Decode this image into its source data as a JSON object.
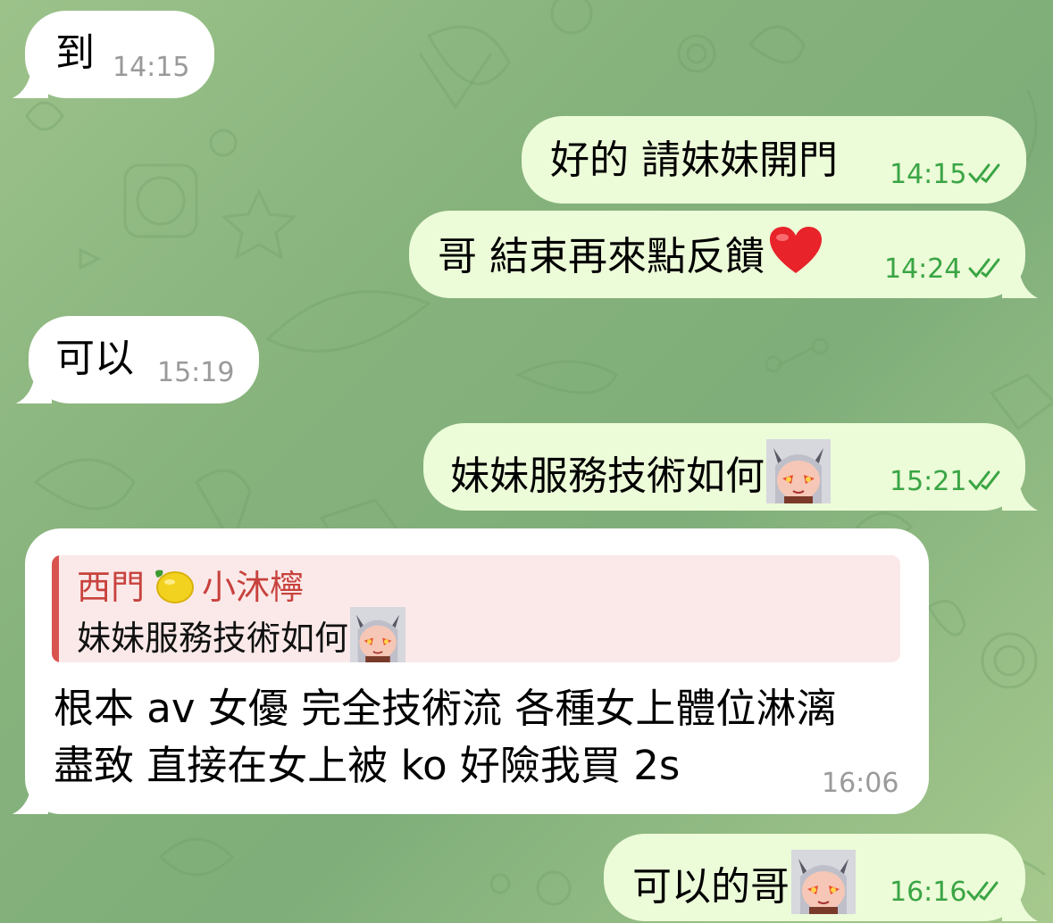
{
  "messages": [
    {
      "id": "m1",
      "direction": "incoming",
      "text": "到",
      "time": "14:15"
    },
    {
      "id": "m2",
      "direction": "outgoing",
      "text": "好的 請妹妹開門",
      "time": "14:15",
      "status": "read"
    },
    {
      "id": "m3",
      "direction": "outgoing",
      "text": "哥 結束再來點反饋",
      "emoji": "red-heart",
      "time": "14:24",
      "status": "read"
    },
    {
      "id": "m4",
      "direction": "incoming",
      "text": "可以",
      "time": "15:19"
    },
    {
      "id": "m5",
      "direction": "outgoing",
      "text": "妹妹服務技術如何",
      "emoji": "demon-girl-sticker",
      "time": "15:21",
      "status": "read"
    },
    {
      "id": "m6",
      "direction": "incoming",
      "reply": {
        "name_part1": "西門",
        "name_emoji": "lemon",
        "name_part2": "小沐檸",
        "text": "妹妹服務技術如何",
        "emoji": "demon-girl-sticker"
      },
      "lines": [
        "根本 av 女優 完全技術流 各種女上體位淋漓",
        "盡致 直接在女上被 ko 好險我買 2s"
      ],
      "time": "16:06"
    },
    {
      "id": "m7",
      "direction": "outgoing",
      "text": "可以的哥",
      "emoji": "demon-girl-sticker",
      "time": "16:16",
      "status": "read"
    }
  ],
  "colors": {
    "incoming_bubble": "#ffffff",
    "outgoing_bubble": "#ecfbd8",
    "outgoing_time": "#3aa544",
    "incoming_time": "#9a9a9a",
    "reply_accent": "#d9534f",
    "reply_bg": "#fbe9e9"
  }
}
